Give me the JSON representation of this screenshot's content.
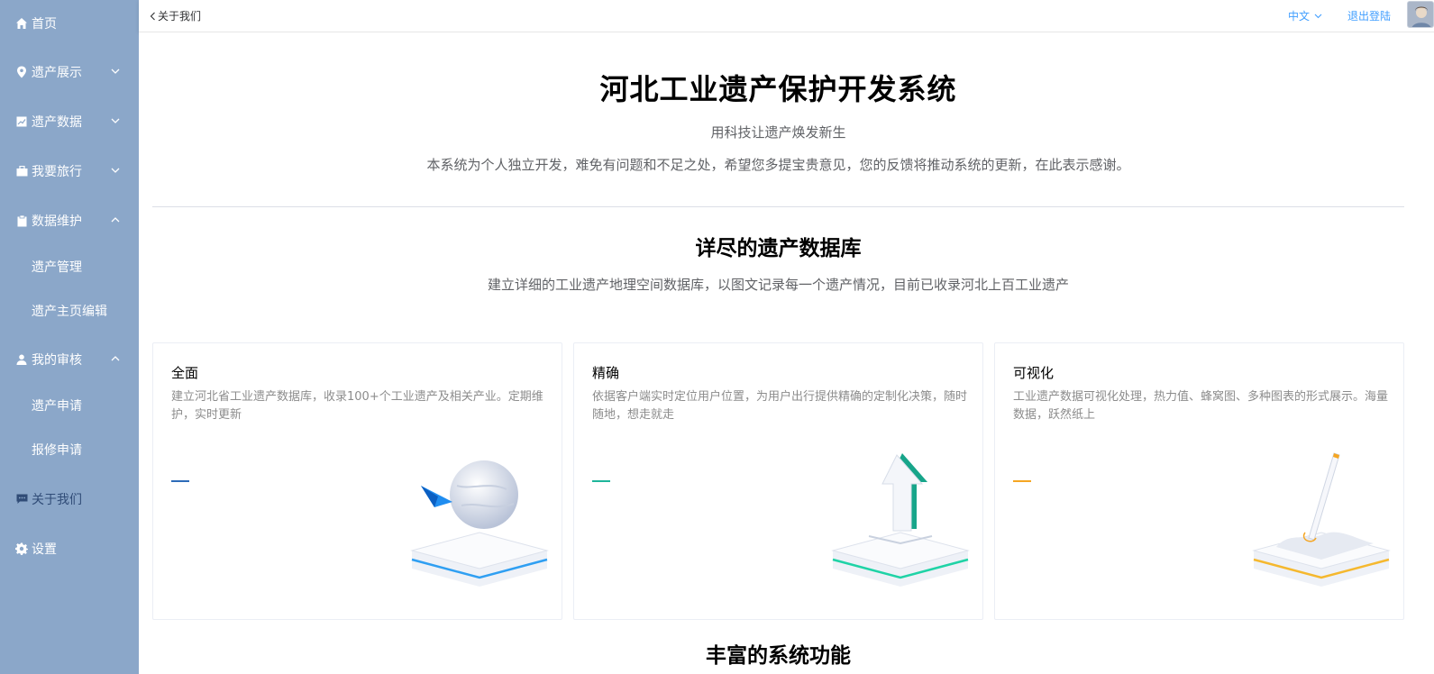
{
  "sidebar": {
    "items": [
      {
        "label": "首页",
        "icon": "home-icon"
      },
      {
        "label": "遗产展示",
        "icon": "location-icon"
      },
      {
        "label": "遗产数据",
        "icon": "chart-icon"
      },
      {
        "label": "我要旅行",
        "icon": "suitcase-icon"
      },
      {
        "label": "数据维护",
        "icon": "clipboard-icon"
      },
      {
        "label": "遗产管理"
      },
      {
        "label": "遗产主页编辑"
      },
      {
        "label": "我的审核",
        "icon": "user-icon"
      },
      {
        "label": "遗产申请"
      },
      {
        "label": "报修申请"
      },
      {
        "label": "关于我们",
        "icon": "chat-icon"
      },
      {
        "label": "设置",
        "icon": "gear-icon"
      }
    ],
    "background": "#8ba7c9",
    "active_color": "#304c77"
  },
  "header": {
    "breadcrumb": "关于我们",
    "language": "中文",
    "logout": "退出登陆"
  },
  "main": {
    "title": "河北工业遗产保护开发系统",
    "subtitle": "用科技让遗产焕发新生",
    "description": "本系统为个人独立开发，难免有问题和不足之处，希望您多提宝贵意见，您的反馈将推动系统的更新，在此表示感谢。",
    "section1": {
      "title": "详尽的遗产数据库",
      "description": "建立详细的工业遗产地理空间数据库，以图文记录每一个遗产情况，目前已收录河北上百工业遗产"
    },
    "cards": [
      {
        "title": "全面",
        "text": "建立河北省工业遗产数据库，收录100+个工业遗产及相关产业。定期维护，实时更新",
        "accent": "#2d6bb8"
      },
      {
        "title": "精确",
        "text": "依据客户端实时定位用户位置，为用户出行提供精确的定制化决策，随时随地，想走就走",
        "accent": "#1fb59a"
      },
      {
        "title": "可视化",
        "text": "工业遗产数据可视化处理，热力值、蜂窝图、多种图表的形式展示。海量数据，跃然纸上",
        "accent": "#f5a623"
      }
    ],
    "section2": {
      "title": "丰富的系统功能"
    }
  }
}
